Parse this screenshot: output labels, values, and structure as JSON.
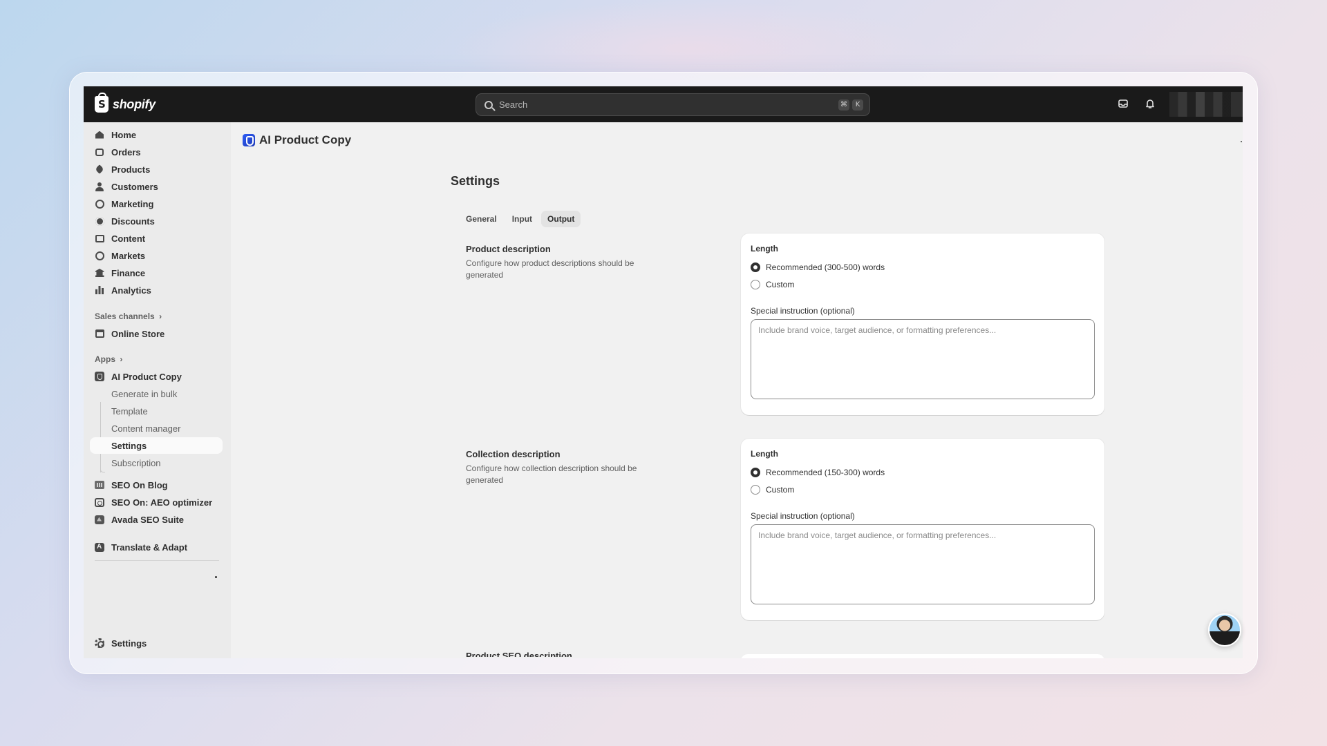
{
  "topbar": {
    "brand": "shopify",
    "search_placeholder": "Search",
    "shortcut_keys": [
      "⌘",
      "K"
    ]
  },
  "sidebar": {
    "main_items": [
      {
        "label": "Home",
        "icon": "home-icon"
      },
      {
        "label": "Orders",
        "icon": "orders-icon"
      },
      {
        "label": "Products",
        "icon": "tag-icon"
      },
      {
        "label": "Customers",
        "icon": "person-icon"
      },
      {
        "label": "Marketing",
        "icon": "target-icon"
      },
      {
        "label": "Discounts",
        "icon": "discount-icon"
      },
      {
        "label": "Content",
        "icon": "content-icon"
      },
      {
        "label": "Markets",
        "icon": "globe-icon"
      },
      {
        "label": "Finance",
        "icon": "bank-icon"
      },
      {
        "label": "Analytics",
        "icon": "bar-chart-icon"
      }
    ],
    "sales_channels_label": "Sales channels",
    "online_store": "Online Store",
    "apps_label": "Apps",
    "app_name": "AI Product Copy",
    "app_subitems": [
      "Generate in bulk",
      "Template",
      "Content manager",
      "Settings",
      "Subscription"
    ],
    "other_apps": [
      "SEO On Blog",
      "SEO On: AEO optimizer",
      "Avada SEO Suite"
    ],
    "translate_app": "Translate & Adapt",
    "settings": "Settings"
  },
  "main": {
    "app_title": "AI Product Copy",
    "page_heading": "Settings",
    "tabs": [
      {
        "label": "General",
        "active": false
      },
      {
        "label": "Input",
        "active": false
      },
      {
        "label": "Output",
        "active": true
      }
    ],
    "sections": [
      {
        "title": "Product description",
        "description": "Configure how product descriptions should be generated",
        "length_label": "Length",
        "options": [
          {
            "label": "Recommended (300-500) words",
            "selected": true
          },
          {
            "label": "Custom",
            "selected": false
          }
        ],
        "instruction_label": "Special instruction (optional)",
        "instruction_placeholder": "Include brand voice, target audience, or formatting preferences..."
      },
      {
        "title": "Collection description",
        "description": "Configure how collection description should be generated",
        "length_label": "Length",
        "options": [
          {
            "label": "Recommended (150-300) words",
            "selected": true
          },
          {
            "label": "Custom",
            "selected": false
          }
        ],
        "instruction_label": "Special instruction (optional)",
        "instruction_placeholder": "Include brand voice, target audience, or formatting preferences..."
      }
    ],
    "next_section_title": "Product SEO description"
  },
  "colors": {
    "topbar": "#1a1a1a",
    "sidebar": "#ebebeb",
    "content_bg": "#f1f1f1",
    "card": "#ffffff",
    "text": "#303030",
    "muted_text": "#616161",
    "app_logo_blue": "#2d5cf6"
  }
}
